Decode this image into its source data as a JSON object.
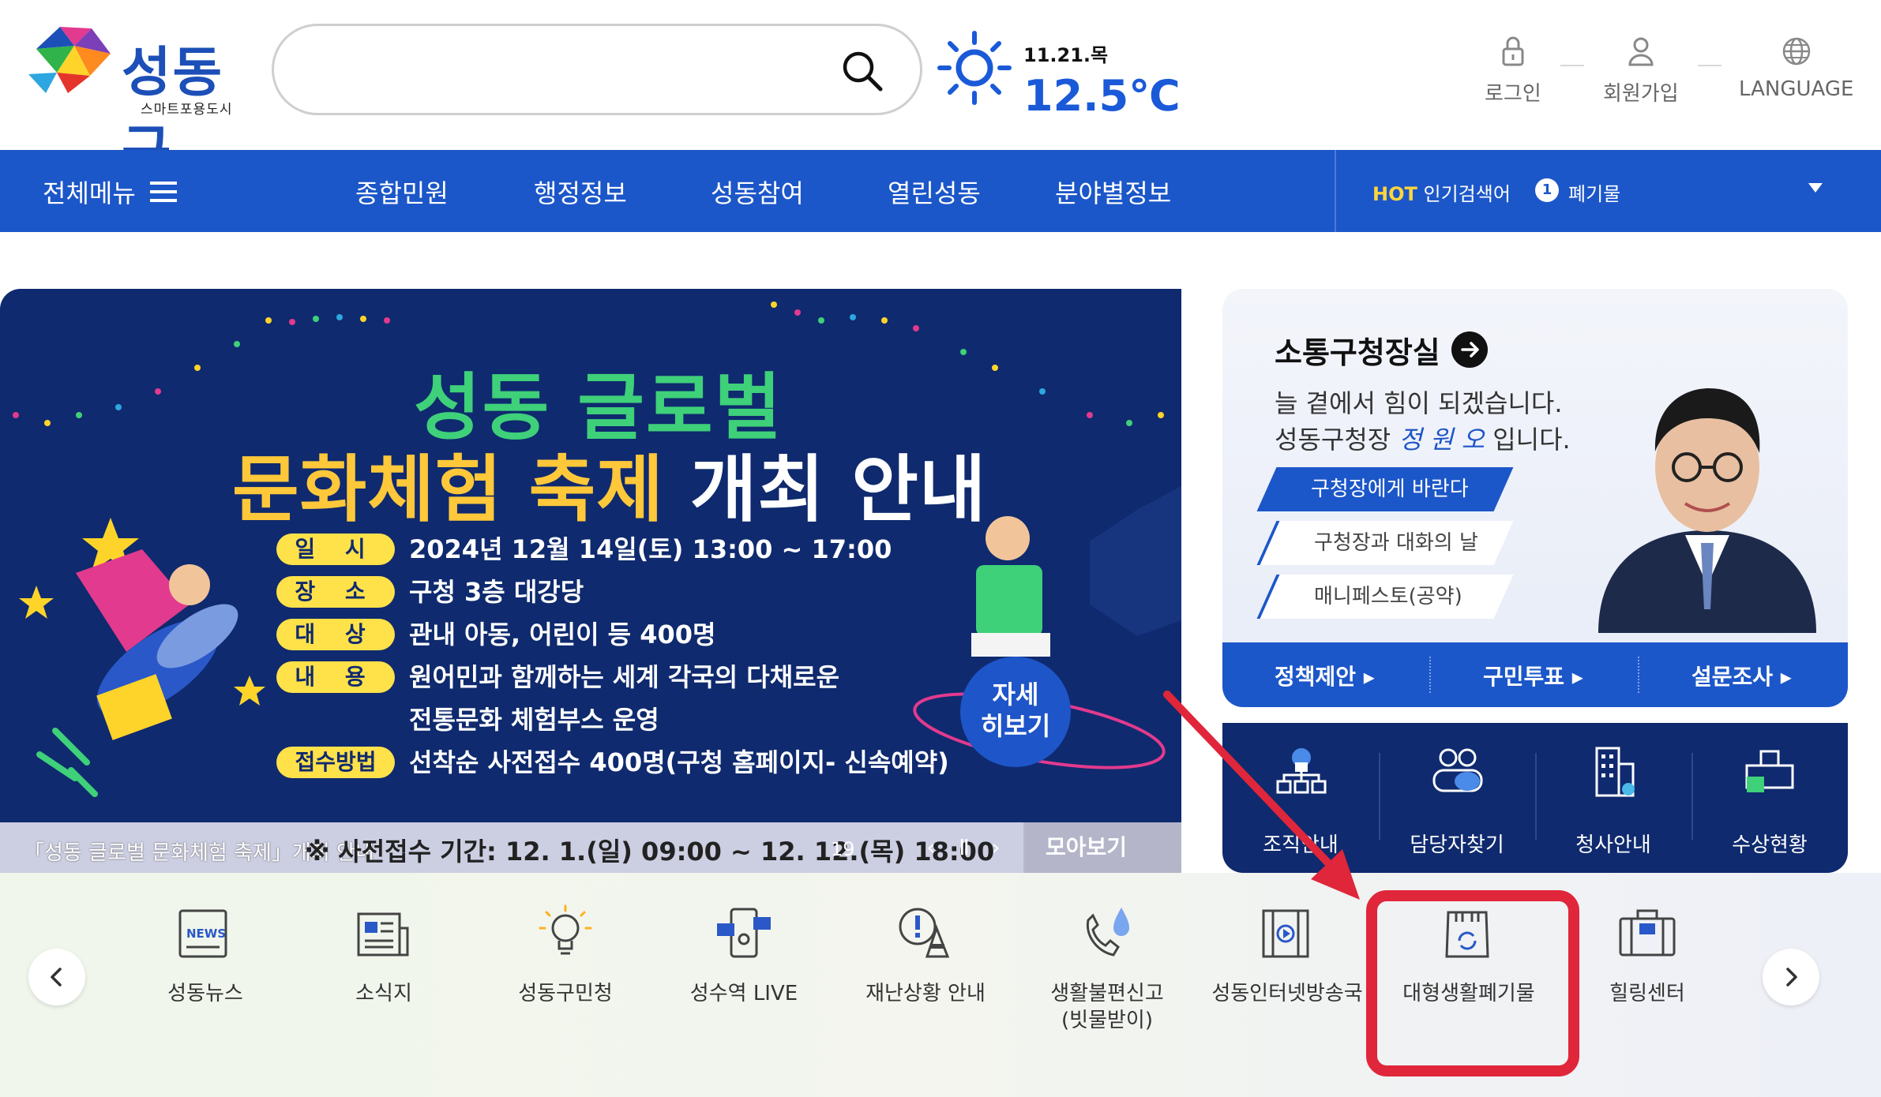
{
  "header": {
    "logo_text": "성동구",
    "logo_sub": "스마트포용도시",
    "search_placeholder": "",
    "weather": {
      "date": "11.21.목",
      "temp": "12.5℃"
    },
    "util": [
      {
        "label": "로그인",
        "icon": "lock-icon"
      },
      {
        "label": "회원가입",
        "icon": "person-icon"
      },
      {
        "label": "LANGUAGE",
        "icon": "globe-icon"
      }
    ]
  },
  "nav": {
    "all_menu": "전체메뉴",
    "items": [
      "종합민원",
      "행정정보",
      "성동참여",
      "열린성동",
      "분야별정보"
    ],
    "hot_label": "HOT",
    "hot_suffix": "인기검색어",
    "hot_rank": "1",
    "hot_term": "폐기물"
  },
  "banner": {
    "title1": "성동 글로벌",
    "title2_yellow": "문화체험 축제",
    "title2_white": " 개최 안내",
    "rows": [
      {
        "label": "일 시",
        "text": "2024년 12월 14일(토) 13:00 ~ 17:00"
      },
      {
        "label": "장 소",
        "text": "구청 3층 대강당"
      },
      {
        "label": "대 상",
        "text": "관내 아동, 어린이 등 400명"
      },
      {
        "label": "내 용",
        "text": "원어민과 함께하는 세계 각국의 다채로운"
      },
      {
        "label": "",
        "text": "전통문화 체험부스 운영"
      },
      {
        "label": "접수방법",
        "text": "선착순 사전접수 400명(구청 홈페이지- 신속예약)"
      }
    ],
    "detail_btn": "자세\n히보기",
    "caption": "「성동 글로벌 문화체험 축제」개최 안내",
    "overlay_text": "※ 사전접수 기간: 12. 1.(일) 09:00 ~ 12. 12.(목) 18:00",
    "counter": "19",
    "more": "모아보기"
  },
  "mayor": {
    "title": "소통구청장실",
    "line1": "늘 곁에서 힘이 되겠습니다.",
    "line2_pre": "성동구청장 ",
    "line2_sig": "정 원 오",
    "line2_post": " 입니다.",
    "links": [
      "구청장에게 바란다",
      "구청장과 대화의 날",
      "매니페스토(공약)"
    ],
    "bottom": [
      "정책제안",
      "구민투표",
      "설문조사"
    ]
  },
  "quick": [
    {
      "label": "조직안내",
      "icon": "org-chart-icon"
    },
    {
      "label": "담당자찾기",
      "icon": "people-search-icon"
    },
    {
      "label": "청사안내",
      "icon": "building-icon"
    },
    {
      "label": "수상현황",
      "icon": "award-icon"
    }
  ],
  "services": [
    {
      "label": "성동뉴스",
      "icon": "news-icon"
    },
    {
      "label": "소식지",
      "icon": "newsletter-icon"
    },
    {
      "label": "성동구민청",
      "icon": "lightbulb-icon"
    },
    {
      "label": "성수역 LIVE",
      "icon": "live-camera-icon"
    },
    {
      "label": "재난상황 안내",
      "icon": "warning-cone-icon"
    },
    {
      "label": "생활불편신고\n(빗물받이)",
      "icon": "phone-drop-icon"
    },
    {
      "label": "성동인터넷방송국",
      "icon": "film-icon"
    },
    {
      "label": "대형생활폐기물",
      "icon": "recycle-bag-icon"
    },
    {
      "label": "힐링센터",
      "icon": "briefcase-icon"
    }
  ],
  "colors": {
    "brand_blue": "#1c57c9",
    "navy": "#0f2a6e",
    "highlight_red": "#e0263a",
    "hot_yellow": "#ffd53d"
  }
}
